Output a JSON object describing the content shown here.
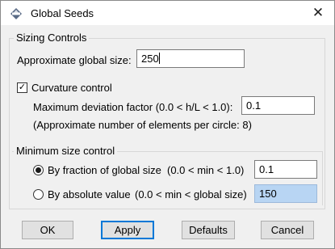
{
  "window": {
    "title": "Global Seeds",
    "icon": "abaqus-app-icon"
  },
  "sizing_controls": {
    "group_label": "Sizing Controls",
    "approx_size_label": "Approximate global size:",
    "approx_size_value": "250"
  },
  "curvature": {
    "checkbox_label": "Curvature control",
    "checked": true,
    "max_deviation_label": "Maximum deviation factor (0.0 < h/L < 1.0):",
    "max_deviation_value": "0.1",
    "elements_note": "(Approximate number of elements per circle: 8)"
  },
  "min_size": {
    "group_label": "Minimum size control",
    "fraction_label": "By fraction of global size",
    "fraction_range": "(0.0 < min < 1.0)",
    "fraction_value": "0.1",
    "fraction_selected": true,
    "absolute_label": "By absolute value",
    "absolute_range": "(0.0 < min < global size)",
    "absolute_value": "150",
    "absolute_selected": false
  },
  "buttons": {
    "ok": "OK",
    "apply": "Apply",
    "defaults": "Defaults",
    "cancel": "Cancel"
  }
}
